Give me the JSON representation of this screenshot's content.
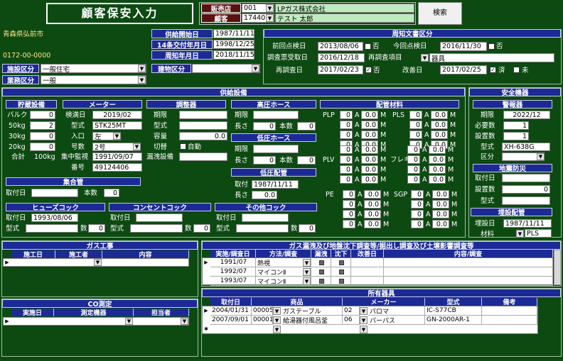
{
  "title": "顧客保安入力",
  "header": {
    "dealer_label": "販売店",
    "dealer_code": "001",
    "dealer_name": "LPガス株式会社",
    "customer_label": "顧客",
    "customer_code": "17440",
    "customer_name": "テスト 太郎",
    "search_label": "検索"
  },
  "left": {
    "address": "青森県弘前市",
    "phone": "0172-00-0000",
    "facility_label": "施設区分",
    "facility_value": "一般住宅",
    "business_label": "業務区分",
    "business_value": "一般"
  },
  "dates": {
    "supply_start_label": "供給開始日",
    "supply_start_value": "1987/11/11",
    "art14_label": "14条交付年月日",
    "art14_value": "1998/12/25",
    "notice_label": "周知年月日",
    "notice_value": "2018/11/15",
    "building_label": "建物区分",
    "building_value": ""
  },
  "notice": {
    "title": "周知文書区分",
    "prev_label": "前回点検日",
    "prev_value": "2013/08/06",
    "prev_check": "否",
    "this_label": "今回点検日",
    "this_value": "2016/11/30",
    "this_check": "否",
    "reinsp_rcv_label": "調査票受取日",
    "reinsp_rcv_value": "2016/12/18",
    "reinsp_item_label": "再調査項目",
    "reinsp_item_value": "器具",
    "reinsp_label": "再調査日",
    "reinsp_value": "2017/02/23",
    "reinsp_check": "否",
    "fix_label": "改善日",
    "fix_value": "2017/02/25",
    "fix_done": "済",
    "fix_not": "未"
  },
  "supply": {
    "title": "供給設備",
    "storage": {
      "title": "貯蔵設備",
      "bulk_label": "バルク",
      "bulk": "0",
      "k50_label": "50kg",
      "k50": "2",
      "k30_label": "30kg",
      "k30": "0",
      "k20_label": "20kg",
      "k20": "0",
      "total_label": "合計",
      "total": "100kg"
    },
    "meter": {
      "title": "メーター",
      "insp_label": "検満日",
      "insp": "2019/02",
      "model_label": "型式",
      "model": "STK25MT",
      "inlet_label": "入口",
      "inlet": "左",
      "num_label": "号数",
      "num": "2号",
      "monitor_label": "集中監視",
      "monitor": "1991/09/07",
      "no_label": "番号",
      "no": "49124406"
    },
    "regulator": {
      "title": "調整器",
      "term_label": "期限",
      "term": "",
      "model_label": "型式",
      "model": "",
      "cap_label": "容量",
      "cap": "0.0",
      "switch_label": "切替",
      "switch_auto": "自動",
      "leak_label": "漏洩設備",
      "leak": ""
    },
    "hp_hose": {
      "title": "高圧ホース",
      "term_label": "期限",
      "term": "",
      "len_label": "長さ",
      "len": "0",
      "count_label": "本数",
      "count": "0"
    },
    "lp_hose": {
      "title": "低圧ホース",
      "term_label": "期限",
      "term": "",
      "len_label": "長さ",
      "len": "0",
      "count_label": "本数",
      "count": "0"
    },
    "lp_pipe": {
      "title": "低圧配管",
      "date_label": "取付",
      "date": "1987/11/11",
      "len_label": "長さ",
      "len": "0.0"
    },
    "piping": {
      "title": "配管材料",
      "plp": "PLP",
      "pls": "PLS",
      "plv": "PLV",
      "flex": "フレキ",
      "pe": "PE",
      "sgp": "SGP",
      "a": "A",
      "m": "M",
      "zero": "0",
      "zero2": "0.0"
    },
    "header_pipe": {
      "title": "集合管",
      "date_label": "取付日",
      "date": "",
      "count_label": "本数",
      "count": "0"
    },
    "fuse": {
      "title": "ヒューズコック",
      "date_label": "取付日",
      "date": "1993/08/06",
      "model_label": "型式",
      "model": "",
      "num_label": "数",
      "num": "0"
    },
    "outlet": {
      "title": "コンセントコック",
      "date_label": "取付日",
      "date": "",
      "model_label": "型式",
      "model": "",
      "num_label": "数",
      "num": "0"
    },
    "other": {
      "title": "その他コック",
      "date_label": "取付日",
      "date": "",
      "model_label": "型式",
      "model": "",
      "num_label": "数",
      "num": "0"
    }
  },
  "safety": {
    "title": "安全機器",
    "alarm": {
      "title": "警報器",
      "term_label": "期限",
      "term": "2022/12",
      "need_label": "必要数",
      "need": "1",
      "inst_label": "設置数",
      "inst": "1",
      "model_label": "型式",
      "model": "XH-638G",
      "cat_label": "区分",
      "cat": ""
    },
    "quake": {
      "title": "地震防災",
      "date_label": "取付日",
      "date": "",
      "inst_label": "設置数",
      "inst": "0",
      "model_label": "型式",
      "model": ""
    },
    "buried": {
      "title": "埋設配管",
      "date_label": "埋設日",
      "date": "1987/11/11",
      "mat_label": "材料",
      "mat": "PLS"
    }
  },
  "gas_work": {
    "title": "ガス工事",
    "cols": [
      "施工日",
      "施工者",
      "内容"
    ]
  },
  "leak_survey": {
    "title": "ガス漏洩及び地盤沈下調査等/掘出し調査及び土壌影響調査等",
    "cols": [
      "実施/調査日",
      "方法/調査",
      "漏洩",
      "沈下",
      "改善日",
      "内容/調査"
    ],
    "rows": [
      {
        "date": "1991/07",
        "method": "熱視"
      },
      {
        "date": "1992/07",
        "method": "マイコンⅡ"
      },
      {
        "date": "1993/07",
        "method": "マイコンⅡ"
      }
    ]
  },
  "co": {
    "title": "CO測定",
    "cols": [
      "実施日",
      "測定機器",
      "担当者"
    ]
  },
  "appliances": {
    "title": "所有器具",
    "cols": [
      "取付日",
      "商品",
      "メーカー",
      "型式",
      "備考"
    ],
    "rows": [
      {
        "date": "2004/01/31",
        "code": "00005",
        "name": "ガステーブル",
        "mcode": "02",
        "maker": "パロマ",
        "model": "IC-S77CB",
        "note": ""
      },
      {
        "date": "2007/09/01",
        "code": "00001",
        "name": "給湯器付風呂釜",
        "mcode": "06",
        "maker": "パーパス",
        "model": "GN-2000AR-1",
        "note": ""
      }
    ]
  }
}
